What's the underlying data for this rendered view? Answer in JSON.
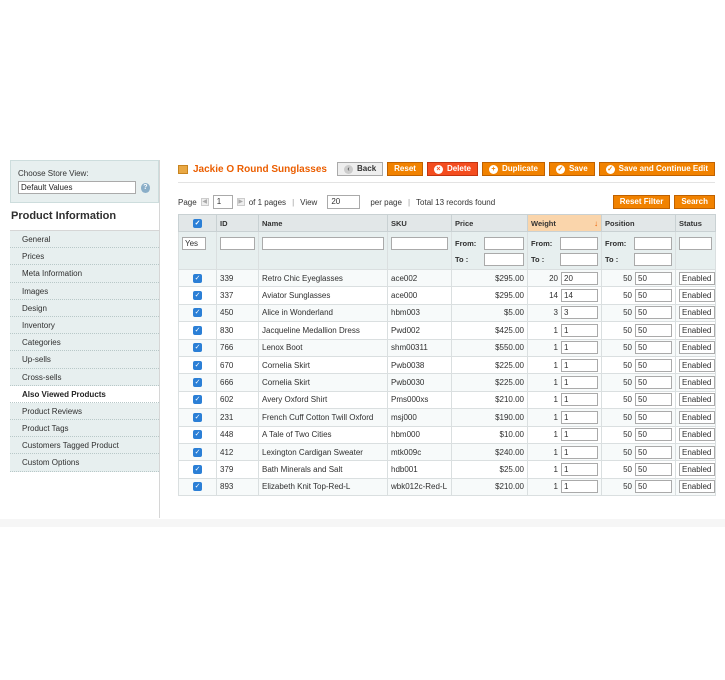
{
  "store": {
    "label": "Choose Store View:",
    "value": "Default Values"
  },
  "sidebar": {
    "title": "Product Information",
    "items": [
      {
        "label": "General"
      },
      {
        "label": "Prices"
      },
      {
        "label": "Meta Information"
      },
      {
        "label": "Images"
      },
      {
        "label": "Design"
      },
      {
        "label": "Inventory"
      },
      {
        "label": "Categories"
      },
      {
        "label": "Up-sells"
      },
      {
        "label": "Cross-sells"
      },
      {
        "label": "Also Viewed Products"
      },
      {
        "label": "Product Reviews"
      },
      {
        "label": "Product Tags"
      },
      {
        "label": "Customers Tagged Product"
      },
      {
        "label": "Custom Options"
      }
    ]
  },
  "header": {
    "title": "Jackie O Round Sunglasses",
    "buttons": {
      "back": "Back",
      "reset": "Reset",
      "delete": "Delete",
      "duplicate": "Duplicate",
      "save": "Save",
      "save_continue": "Save and Continue Edit"
    }
  },
  "pager": {
    "page_label": "Page",
    "page_value": "1",
    "of_pages": "of 1 pages",
    "view_label": "View",
    "view_value": "20",
    "per_page": "per page",
    "records": "Total 13 records found",
    "reset_filter": "Reset Filter",
    "search": "Search"
  },
  "columns": {
    "id": "ID",
    "name": "Name",
    "sku": "SKU",
    "price": "Price",
    "weight": "Weight",
    "position": "Position",
    "status": "Status"
  },
  "filter": {
    "select_value": "Yes",
    "from": "From:",
    "to": "To :"
  },
  "rows": [
    {
      "id": "339",
      "name": "Retro Chic Eyeglasses",
      "sku": "ace002",
      "price": "$295.00",
      "weight": "20",
      "weight_input": "20",
      "position": "50",
      "position_input": "50",
      "status": "Enabled"
    },
    {
      "id": "337",
      "name": "Aviator Sunglasses",
      "sku": "ace000",
      "price": "$295.00",
      "weight": "14",
      "weight_input": "14",
      "position": "50",
      "position_input": "50",
      "status": "Enabled"
    },
    {
      "id": "450",
      "name": "Alice in Wonderland",
      "sku": "hbm003",
      "price": "$5.00",
      "weight": "3",
      "weight_input": "3",
      "position": "50",
      "position_input": "50",
      "status": "Enabled"
    },
    {
      "id": "830",
      "name": "Jacqueline Medallion Dress",
      "sku": "Pwd002",
      "price": "$425.00",
      "weight": "1",
      "weight_input": "1",
      "position": "50",
      "position_input": "50",
      "status": "Enabled"
    },
    {
      "id": "766",
      "name": "Lenox Boot",
      "sku": "shm00311",
      "price": "$550.00",
      "weight": "1",
      "weight_input": "1",
      "position": "50",
      "position_input": "50",
      "status": "Enabled"
    },
    {
      "id": "670",
      "name": "Cornelia Skirt",
      "sku": "Pwb0038",
      "price": "$225.00",
      "weight": "1",
      "weight_input": "1",
      "position": "50",
      "position_input": "50",
      "status": "Enabled"
    },
    {
      "id": "666",
      "name": "Cornelia Skirt",
      "sku": "Pwb0030",
      "price": "$225.00",
      "weight": "1",
      "weight_input": "1",
      "position": "50",
      "position_input": "50",
      "status": "Enabled"
    },
    {
      "id": "602",
      "name": "Avery Oxford Shirt",
      "sku": "Pms000xs",
      "price": "$210.00",
      "weight": "1",
      "weight_input": "1",
      "position": "50",
      "position_input": "50",
      "status": "Enabled"
    },
    {
      "id": "231",
      "name": "French Cuff Cotton Twill Oxford",
      "sku": "msj000",
      "price": "$190.00",
      "weight": "1",
      "weight_input": "1",
      "position": "50",
      "position_input": "50",
      "status": "Enabled"
    },
    {
      "id": "448",
      "name": "A Tale of Two Cities",
      "sku": "hbm000",
      "price": "$10.00",
      "weight": "1",
      "weight_input": "1",
      "position": "50",
      "position_input": "50",
      "status": "Enabled"
    },
    {
      "id": "412",
      "name": "Lexington Cardigan Sweater",
      "sku": "mtk009c",
      "price": "$240.00",
      "weight": "1",
      "weight_input": "1",
      "position": "50",
      "position_input": "50",
      "status": "Enabled"
    },
    {
      "id": "379",
      "name": "Bath Minerals and Salt",
      "sku": "hdb001",
      "price": "$25.00",
      "weight": "1",
      "weight_input": "1",
      "position": "50",
      "position_input": "50",
      "status": "Enabled"
    },
    {
      "id": "893",
      "name": "Elizabeth Knit Top-Red-L",
      "sku": "wbk012c-Red-L",
      "price": "$210.00",
      "weight": "1",
      "weight_input": "1",
      "position": "50",
      "position_input": "50",
      "status": "Enabled"
    }
  ],
  "colors": {
    "accent": "#f18200",
    "title": "#eb5e00",
    "sidebar_bg": "#e7efef",
    "checkbox": "#2b7fd6"
  }
}
